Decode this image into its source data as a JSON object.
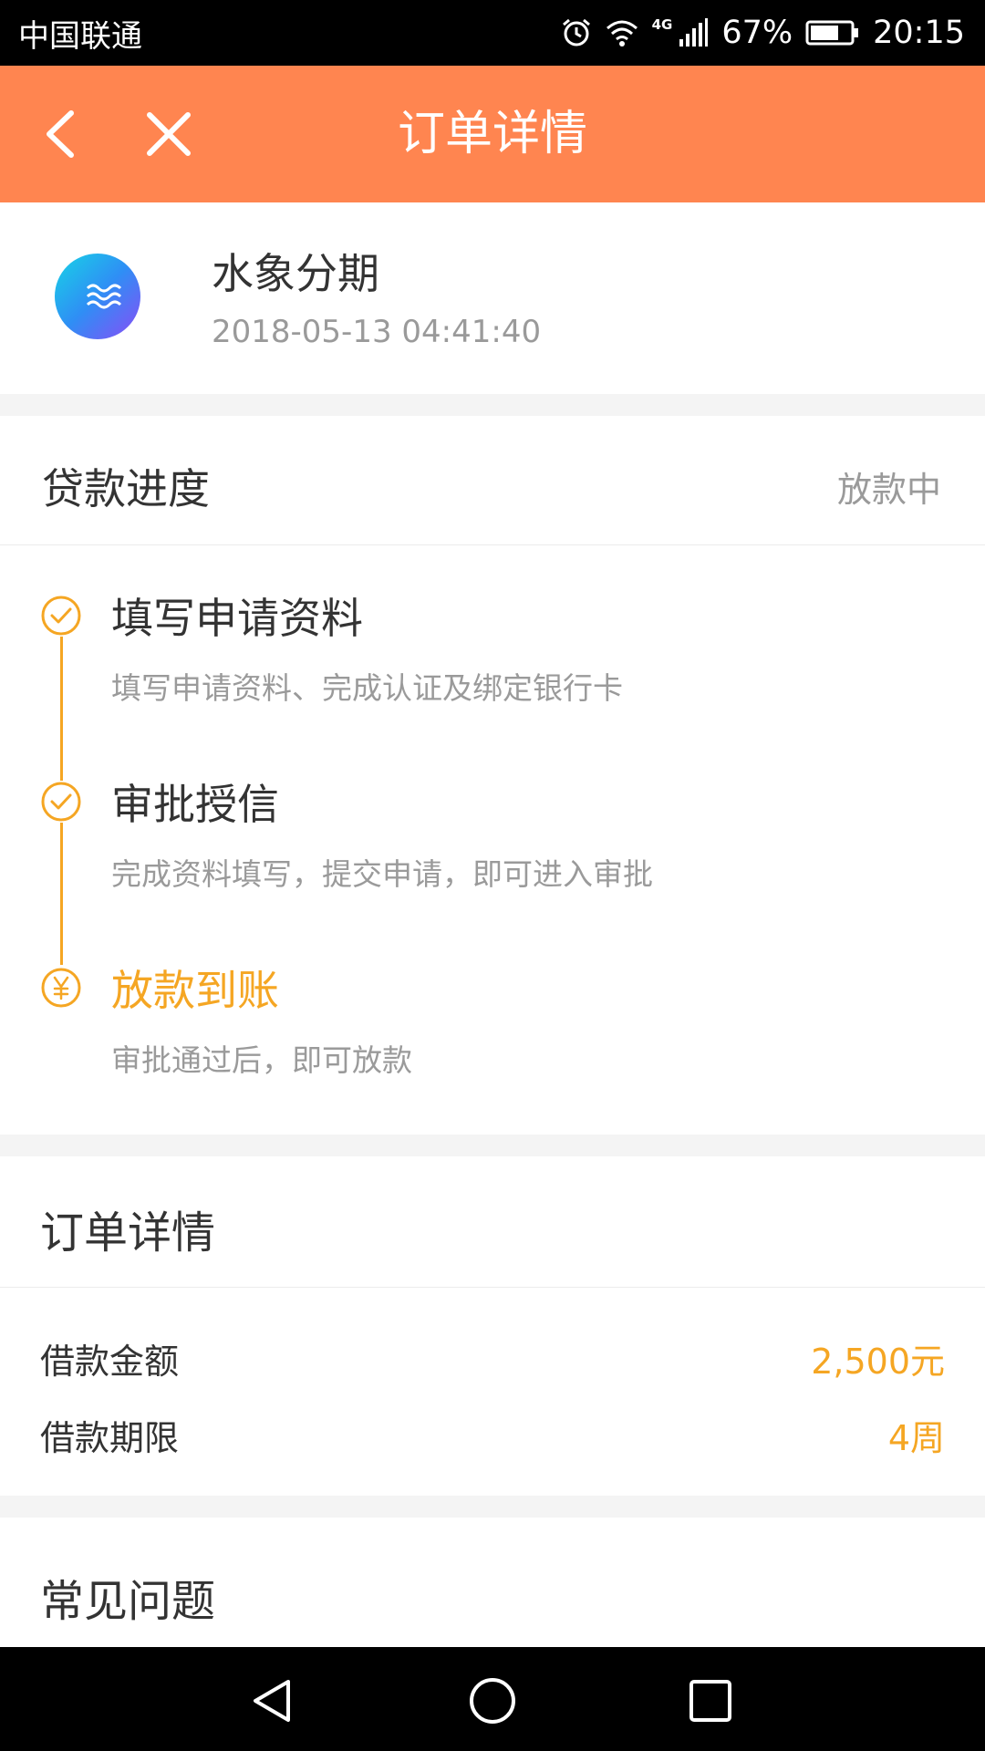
{
  "status_bar": {
    "carrier": "中国联通",
    "network": "4G",
    "battery": "67%",
    "time": "20:15",
    "icons": [
      "alarm-icon",
      "wifi-icon",
      "signal-icon",
      "battery-icon"
    ]
  },
  "navbar": {
    "title": "订单详情",
    "back_icon": "chevron-left-icon",
    "close_icon": "close-icon",
    "background": "#ff8550"
  },
  "product": {
    "name": "水象分期",
    "time": "2018-05-13 04:41:40",
    "logo_icon": "wave-logo-icon"
  },
  "progress": {
    "title": "贷款进度",
    "status": "放款中",
    "steps": [
      {
        "title": "填写申请资料",
        "desc": "填写申请资料、完成认证及绑定银行卡",
        "icon": "check-circle-icon",
        "state": "done"
      },
      {
        "title": "审批授信",
        "desc": "完成资料填写，提交申请，即可进入审批",
        "icon": "check-circle-icon",
        "state": "done"
      },
      {
        "title": "放款到账",
        "desc": "审批通过后，即可放款",
        "icon": "yuan-circle-icon",
        "state": "current"
      }
    ]
  },
  "order": {
    "title": "订单详情",
    "rows": [
      {
        "label": "借款金额",
        "value": "2,500元"
      },
      {
        "label": "借款期限",
        "value": "4周"
      }
    ]
  },
  "faq": {
    "title": "常见问题"
  },
  "colors": {
    "accent": "#f5a623",
    "header": "#ff8550",
    "muted": "#9a9a9a"
  }
}
